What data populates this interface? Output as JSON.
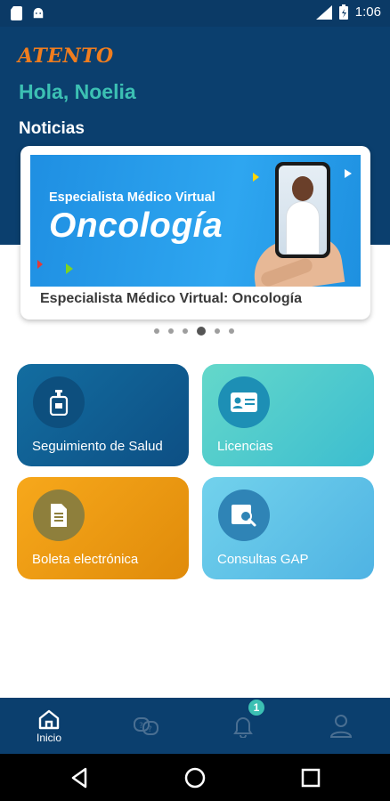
{
  "status_bar": {
    "time": "1:06",
    "icons": [
      "sd-card-icon",
      "android-icon",
      "signal-icon",
      "battery-icon"
    ]
  },
  "header": {
    "logo_text": "ATENTO",
    "greeting": "Hola, Noelia",
    "news_section_title": "Noticias"
  },
  "news": {
    "banner_subtitle": "Especialista Médico Virtual",
    "banner_title": "Oncología",
    "caption": "Especialista Médico Virtual: Oncología",
    "dots_total": 6,
    "active_dot_index": 3
  },
  "tiles": [
    {
      "label": "Seguimiento de Salud",
      "icon": "hand-sanitizer-icon",
      "color": "#0d4f84"
    },
    {
      "label": "Licencias",
      "icon": "id-card-icon",
      "color": "#3cbdd0"
    },
    {
      "label": "Boleta electrónica",
      "icon": "document-icon",
      "color": "#e08b0a"
    },
    {
      "label": "Consultas GAP",
      "icon": "search-document-icon",
      "color": "#4fb3e3"
    }
  ],
  "bottom_nav": {
    "items": [
      {
        "label": "Inicio",
        "icon": "home-icon",
        "active": true
      },
      {
        "label": "",
        "icon": "chat-help-icon",
        "active": false
      },
      {
        "label": "",
        "icon": "bell-icon",
        "active": false,
        "badge": "1"
      },
      {
        "label": "",
        "icon": "user-icon",
        "active": false
      }
    ]
  },
  "colors": {
    "header_bg": "#0b3f6e",
    "accent_teal": "#3cc0b3",
    "logo_orange": "#f07d1e"
  }
}
